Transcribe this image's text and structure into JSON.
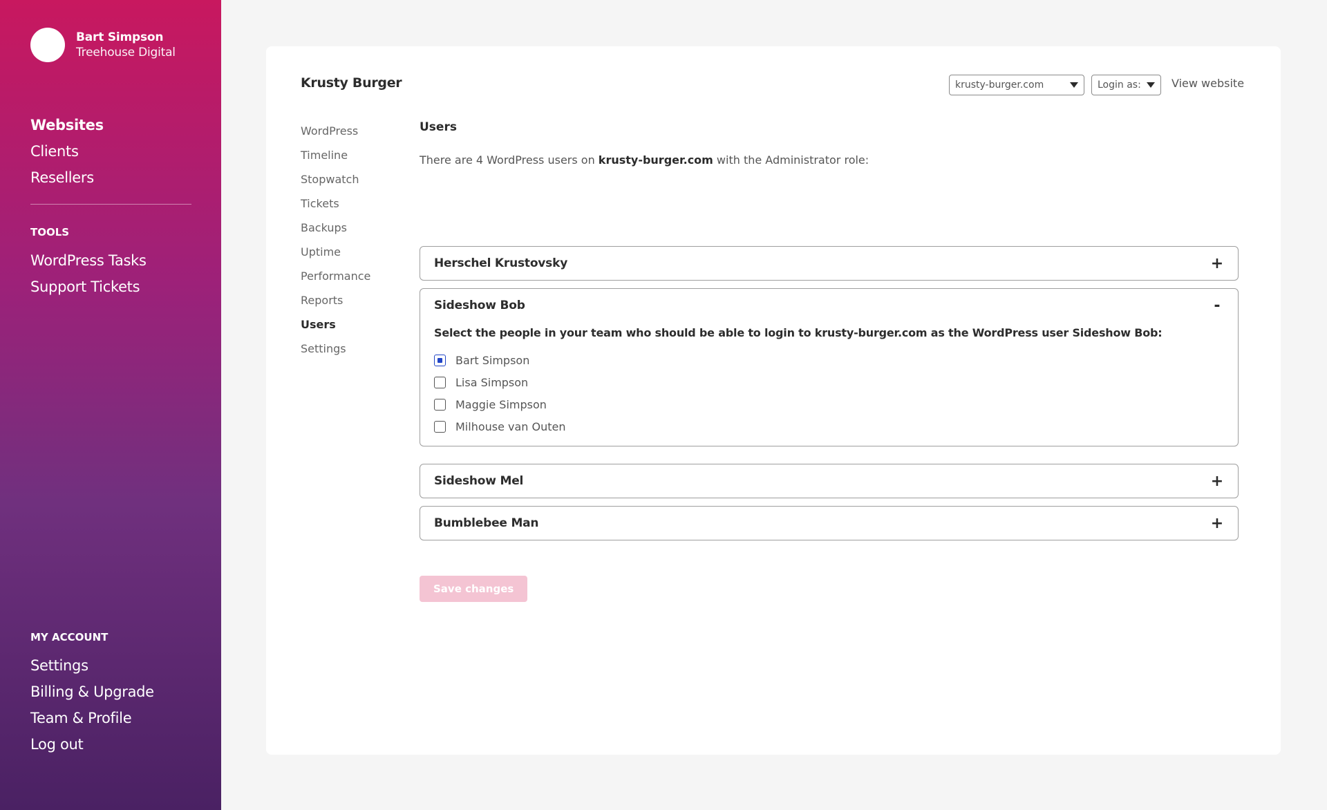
{
  "profile": {
    "name": "Bart Simpson",
    "company": "Treehouse Digital"
  },
  "sidebar": {
    "main_items": [
      {
        "label": "Websites",
        "active": true
      },
      {
        "label": "Clients"
      },
      {
        "label": "Resellers"
      }
    ],
    "tools_label": "TOOLS",
    "tools_items": [
      {
        "label": "WordPress Tasks"
      },
      {
        "label": "Support Tickets"
      }
    ],
    "account_label": "MY ACCOUNT",
    "account_items": [
      {
        "label": "Settings"
      },
      {
        "label": "Billing & Upgrade"
      },
      {
        "label": "Team & Profile"
      },
      {
        "label": "Log out"
      }
    ]
  },
  "header": {
    "site_title": "Krusty Burger",
    "domain_select": "krusty-burger.com",
    "login_select": "Login as:",
    "view_link": "View website"
  },
  "subnav": [
    {
      "label": "WordPress"
    },
    {
      "label": "Timeline"
    },
    {
      "label": "Stopwatch"
    },
    {
      "label": "Tickets"
    },
    {
      "label": "Backups"
    },
    {
      "label": "Uptime"
    },
    {
      "label": "Performance"
    },
    {
      "label": "Reports"
    },
    {
      "label": "Users",
      "active": true
    },
    {
      "label": "Settings"
    }
  ],
  "users": {
    "title": "Users",
    "intro_prefix": "There are 4 WordPress users on ",
    "intro_domain": "krusty-burger.com",
    "intro_suffix": " with the Administrator role:",
    "accordions": [
      {
        "name": "Herschel Krustovsky",
        "toggle": "+"
      },
      {
        "name": "Sideshow Bob",
        "toggle": "-",
        "description": "Select the people in your team who should be able to login to krusty-burger.com as the WordPress user Sideshow Bob:",
        "people": [
          {
            "label": "Bart Simpson",
            "checked": true
          },
          {
            "label": "Lisa Simpson",
            "checked": false
          },
          {
            "label": "Maggie Simpson",
            "checked": false
          },
          {
            "label": "Milhouse van Outen",
            "checked": false
          }
        ]
      },
      {
        "name": "Sideshow Mel",
        "toggle": "+"
      },
      {
        "name": "Bumblebee Man",
        "toggle": "+"
      }
    ],
    "save_label": "Save changes"
  },
  "colors": {
    "sidebar_top": "#c8185f",
    "sidebar_bottom": "#4a2163",
    "checkbox_accent": "#2145c6",
    "save_disabled": "#f4c4d3"
  }
}
